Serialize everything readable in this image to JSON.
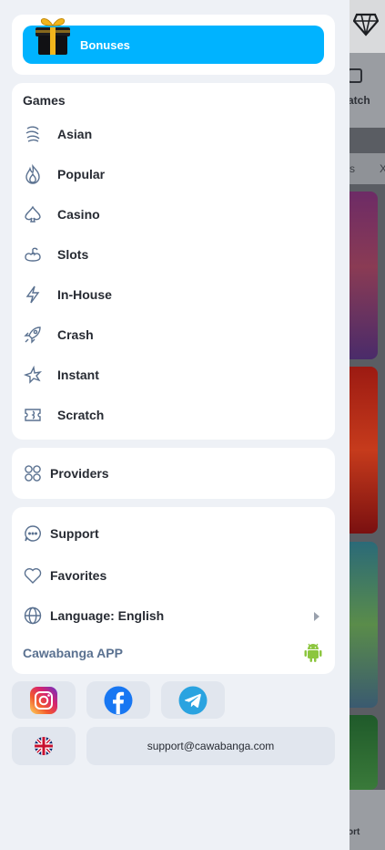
{
  "background": {
    "tab_label": "atch",
    "filter_left": "ys",
    "filter_right": "X",
    "bottom_label": "ort"
  },
  "bonus": {
    "label": "Bonuses",
    "icon": "gift-icon"
  },
  "games": {
    "title": "Games",
    "items": [
      {
        "label": "Asian",
        "icon": "asian-icon"
      },
      {
        "label": "Popular",
        "icon": "flame-icon"
      },
      {
        "label": "Casino",
        "icon": "spade-icon"
      },
      {
        "label": "Slots",
        "icon": "cherry-icon"
      },
      {
        "label": "In-House",
        "icon": "lightning-icon"
      },
      {
        "label": "Crash",
        "icon": "rocket-icon"
      },
      {
        "label": "Instant",
        "icon": "star-icon"
      },
      {
        "label": "Scratch",
        "icon": "ticket-icon"
      }
    ]
  },
  "providers": {
    "label": "Providers",
    "icon": "providers-icon"
  },
  "misc": {
    "support": "Support",
    "favorites": "Favorites",
    "language": "Language: English",
    "app_label": "Cawabanga APP"
  },
  "footer": {
    "email": "support@cawabanga.com",
    "socials": [
      "instagram",
      "facebook",
      "telegram"
    ],
    "flag": "uk-flag-icon"
  },
  "colors": {
    "accent": "#00b3ff",
    "text": "#272b33",
    "panel": "#ffffff",
    "page": "#eef1f6",
    "android": "#8cc63f"
  }
}
